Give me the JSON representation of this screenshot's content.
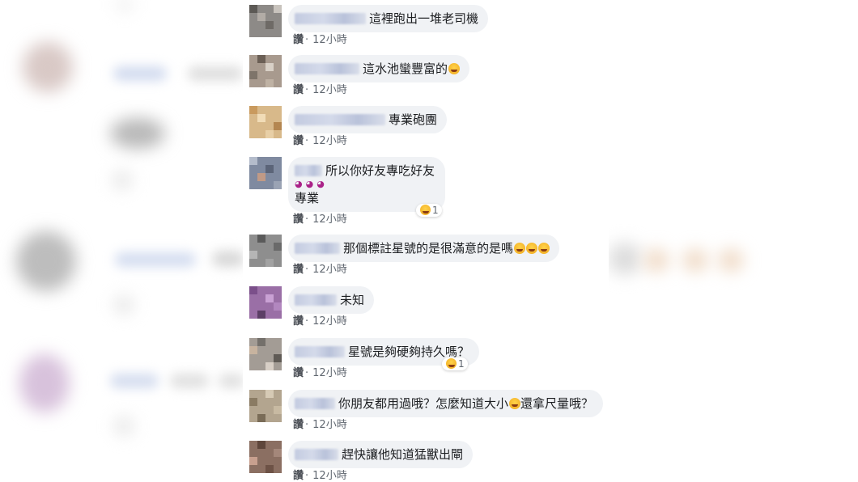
{
  "comments": [
    {
      "text": "這裡跑出一堆老司機",
      "reply": "讚",
      "time": "12小時"
    },
    {
      "text": "這水池蠻豐富的",
      "reply": "讚",
      "time": "12小時"
    },
    {
      "text": "專業砲團",
      "reply": "讚",
      "time": "12小時"
    },
    {
      "text": "所以你好友專吃好友",
      "text2": "專業",
      "reply": "讚",
      "time": "12小時",
      "reactions": "1"
    },
    {
      "text": "那個標註星號的是很滿意的是嗎",
      "reply": "讚",
      "time": "12小時"
    },
    {
      "text": "未知",
      "reply": "讚",
      "time": "12小時"
    },
    {
      "text": "星號是夠硬夠持久嗎？",
      "reply": "讚",
      "time": "12小時",
      "reactions": "1"
    },
    {
      "text": "你朋友都用過哦？怎麼知道大小",
      "text2": "還拿尺量哦？",
      "reply": "讚",
      "time": "12小時"
    },
    {
      "text": "趕快讓他知道猛獸出閘",
      "reply": "讚",
      "time": "12小時"
    }
  ],
  "meta_separator": "·",
  "colors": {
    "bubble": "#f0f2f5",
    "text": "#1c1e21",
    "meta": "#606770"
  }
}
